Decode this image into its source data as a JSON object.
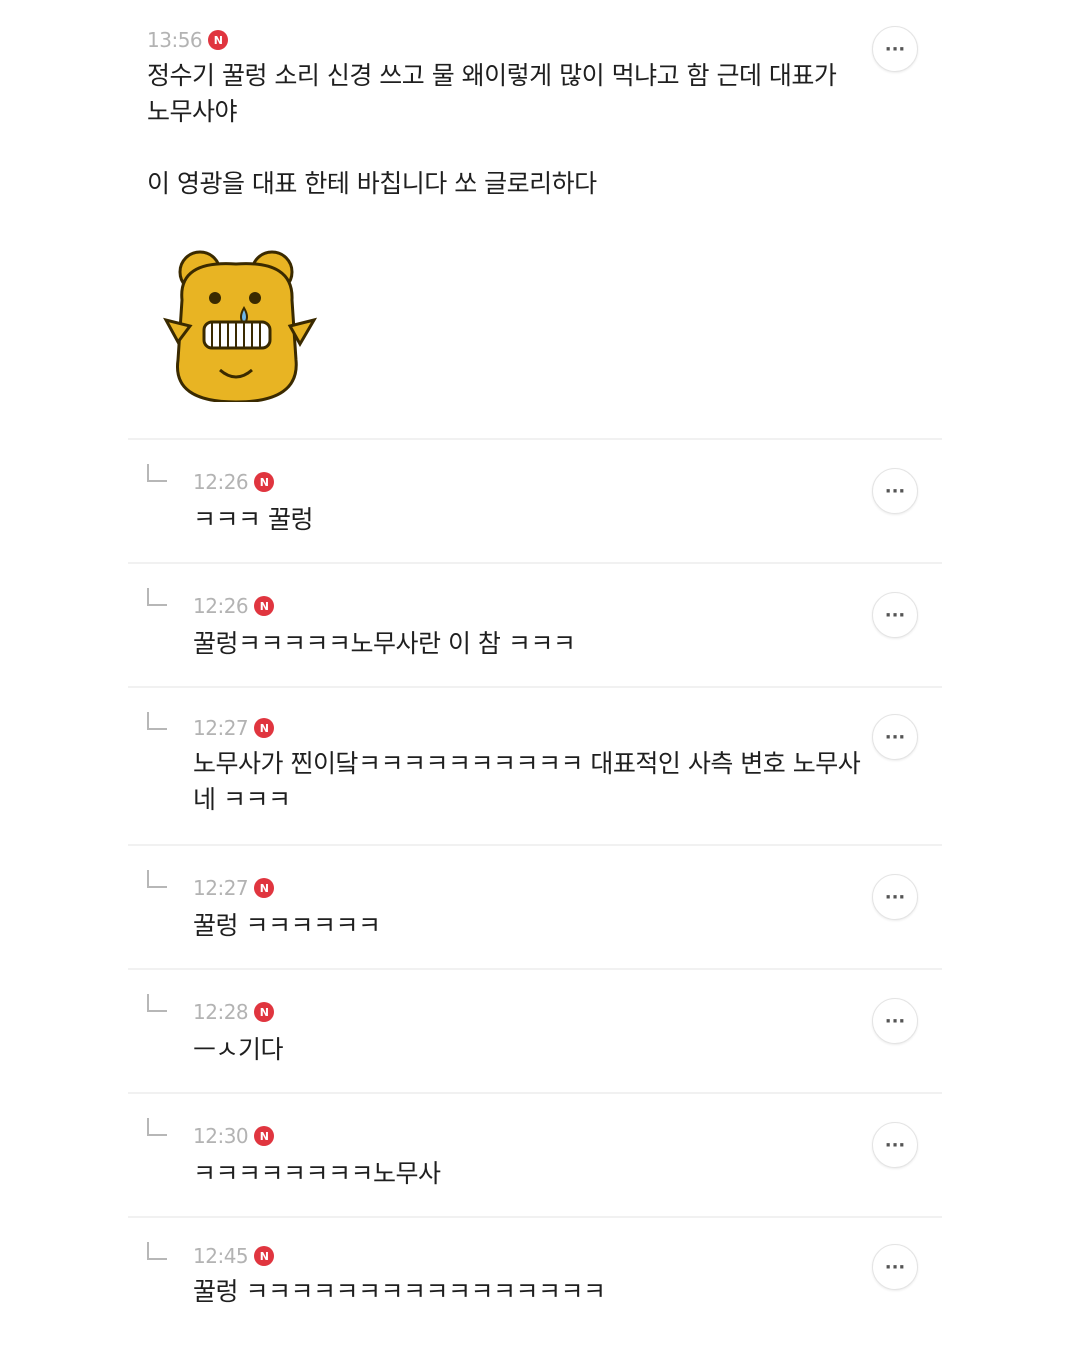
{
  "top_comment": {
    "time": "13:56",
    "badge": "N",
    "line1": "정수기 꿀렁 소리 신경 쓰고 물 왜이렇게 많이 먹냐고 함 근데 대표가 노무사야",
    "line2": "이 영광을 대표 한테 바칩니다 쏘 글로리하다",
    "more_label": "···"
  },
  "replies": [
    {
      "time": "12:26",
      "badge": "N",
      "text": "ㅋㅋㅋ 꿀렁",
      "more_label": "···"
    },
    {
      "time": "12:26",
      "badge": "N",
      "text": "꿀렁ㅋㅋㅋㅋㅋ노무사란 이 참 ㅋㅋㅋ",
      "more_label": "···"
    },
    {
      "time": "12:27",
      "badge": "N",
      "text": "노무사가 찐이닼ㅋㅋㅋㅋㅋㅋㅋㅋㅋㅋ 대표적인 사측 변호 노무사네 ㅋㅋㅋ",
      "more_label": "···"
    },
    {
      "time": "12:27",
      "badge": "N",
      "text": "꿀렁 ㅋㅋㅋㅋㅋㅋ",
      "more_label": "···"
    },
    {
      "time": "12:28",
      "badge": "N",
      "text": "ㅡㅅ기다",
      "more_label": "···"
    },
    {
      "time": "12:30",
      "badge": "N",
      "text": "ㅋㅋㅋㅋㅋㅋㅋㅋ노무사",
      "more_label": "···"
    },
    {
      "time": "12:45",
      "badge": "N",
      "text": "꿀렁 ㅋㅋㅋㅋㅋㅋㅋㅋㅋㅋㅋㅋㅋㅋㅋㅋ",
      "more_label": "···"
    }
  ],
  "colors": {
    "badge": "#e0353f",
    "time": "#b3b3b3",
    "divider": "#f1f1f1"
  },
  "icons": {
    "sticker": "bear-sticker-icon",
    "reply": "reply-arrow-icon",
    "more": "more-options-icon"
  }
}
